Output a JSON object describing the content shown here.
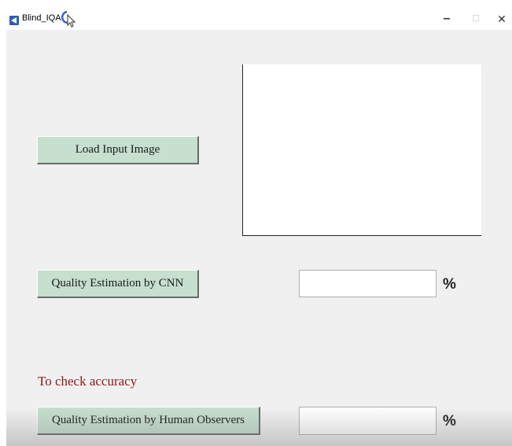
{
  "window": {
    "title": "Blind_IQA",
    "minimize_glyph": "–",
    "maximize_glyph": "☐",
    "close_glyph": "✕"
  },
  "buttons": {
    "load_input_image": "Load Input Image",
    "cnn_estimation": "Quality Estimation by CNN",
    "human_estimation": "Quality Estimation by Human Observers"
  },
  "fields": {
    "cnn_score": "",
    "human_score": "",
    "percent_unit": "%"
  },
  "labels": {
    "accuracy_note": "To check accuracy"
  },
  "colors": {
    "button_face": "#c6dfcf",
    "figure_background": "#f0f0f0",
    "note_text": "#8b1a1a"
  },
  "icons": {
    "app": "matlab-figure-icon",
    "cursor": "busy-cursor-icon"
  }
}
